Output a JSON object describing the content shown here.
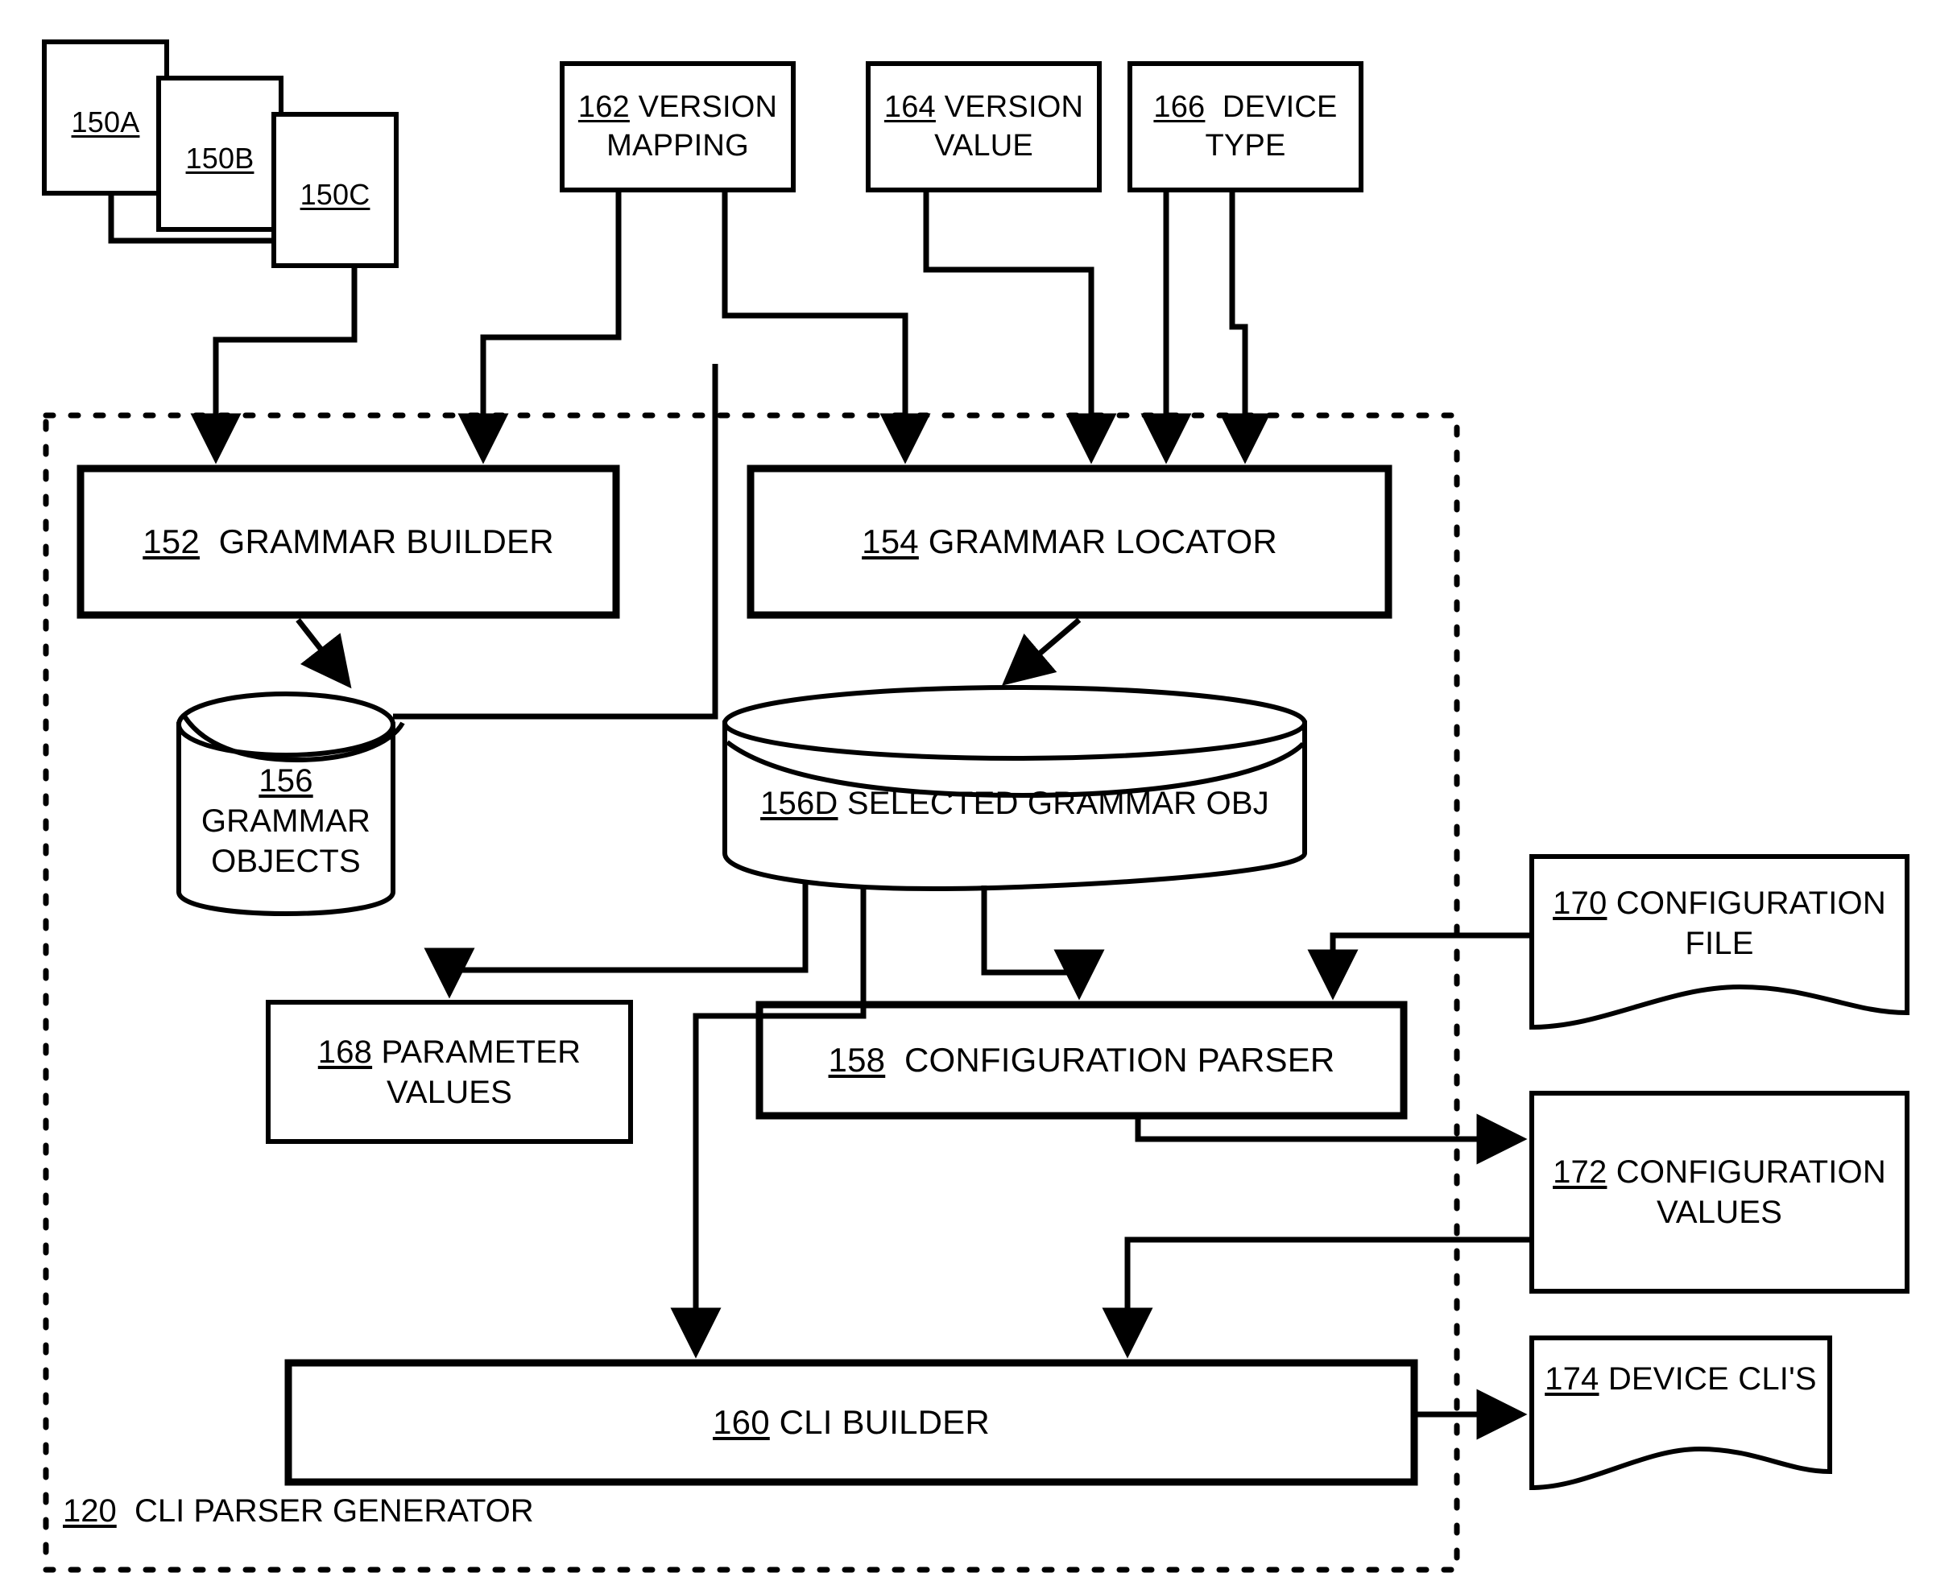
{
  "figure": {
    "title": "CLI Parser Generator block diagram",
    "region": {
      "number": "120",
      "label": "CLI PARSER GENERATOR"
    }
  },
  "nodes": {
    "grammar_files": [
      {
        "number": "150A",
        "label": ""
      },
      {
        "number": "150B",
        "label": ""
      },
      {
        "number": "150C",
        "label": ""
      }
    ],
    "version_mapping": {
      "number": "162",
      "label": "VERSION MAPPING",
      "line1": "162 VERSION",
      "line2": "MAPPING"
    },
    "version_value": {
      "number": "164",
      "label": "VERSION VALUE",
      "line1": "164 VERSION",
      "line2": "VALUE"
    },
    "device_type": {
      "number": "166",
      "label": "DEVICE TYPE",
      "line1": "166  DEVICE",
      "line2": "TYPE"
    },
    "grammar_builder": {
      "number": "152",
      "label": "GRAMMAR BUILDER",
      "line1": "152  GRAMMAR BUILDER"
    },
    "grammar_locator": {
      "number": "154",
      "label": "GRAMMAR LOCATOR",
      "line1": "154 GRAMMAR LOCATOR"
    },
    "grammar_objects": {
      "number": "156",
      "label": "GRAMMAR OBJECTS",
      "line1": "156 GRAMMAR",
      "line2": "OBJECTS"
    },
    "selected_grammar_obj": {
      "number": "156D",
      "label": "SELECTED GRAMMAR OBJ",
      "line1": "156D SELECTED GRAMMAR OBJ"
    },
    "parameter_values": {
      "number": "168",
      "label": "PARAMETER VALUES",
      "line1": "168 PARAMETER",
      "line2": "VALUES"
    },
    "configuration_parser": {
      "number": "158",
      "label": "CONFIGURATION PARSER",
      "line1": "158  CONFIGURATION PARSER"
    },
    "configuration_file": {
      "number": "170",
      "label": "CONFIGURATION FILE",
      "line1": "170 CONFIGURATION",
      "line2": "FILE"
    },
    "configuration_values": {
      "number": "172",
      "label": "CONFIGURATION VALUES",
      "line1": "172 CONFIGURATION",
      "line2": "VALUES"
    },
    "device_clis": {
      "number": "174",
      "label": "DEVICE CLI'S",
      "line1": "174 DEVICE CLI'S"
    },
    "cli_builder": {
      "number": "160",
      "label": "CLI BUILDER",
      "line1": "160 CLI BUILDER"
    }
  },
  "colors": {
    "stroke": "#000000",
    "background": "#ffffff"
  }
}
